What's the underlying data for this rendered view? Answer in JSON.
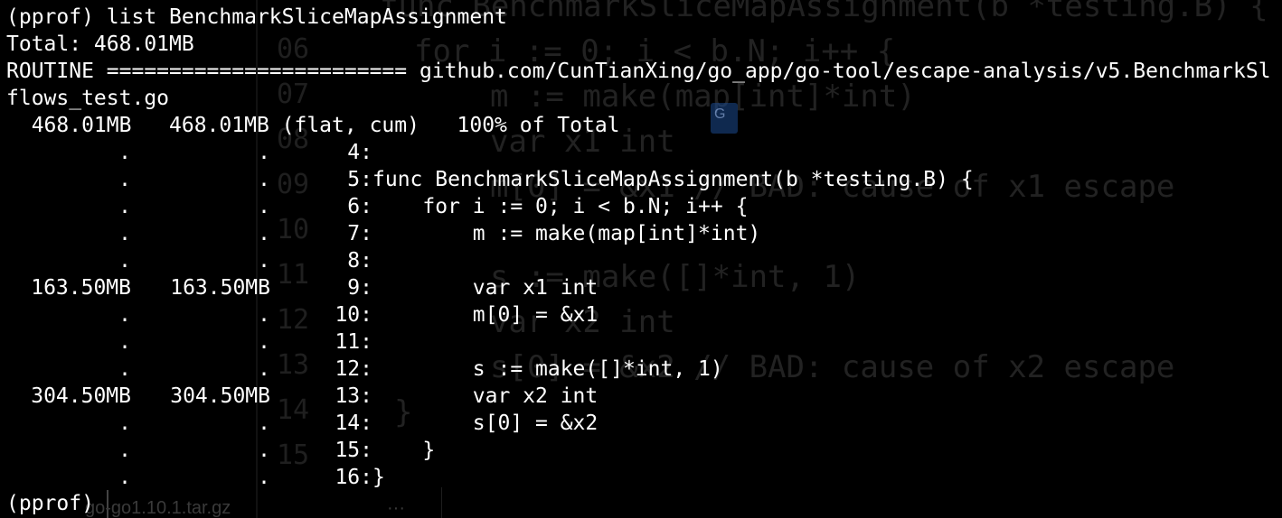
{
  "background_editor": {
    "lines": [
      {
        "num": "",
        "code": "func BenchmarkSliceMapAssignment(b *testing.B) {"
      },
      {
        "num": "06",
        "code": "for i := 0; i < b.N; i++ {"
      },
      {
        "num": "07",
        "code": "m := make(map[int]*int)"
      },
      {
        "num": "08",
        "code": "var x1 int"
      },
      {
        "num": "09",
        "code": "m[0] = &x1 // BAD: cause of x1 escape"
      },
      {
        "num": "10",
        "code": ""
      },
      {
        "num": "11",
        "code": "s := make([]*int, 1)"
      },
      {
        "num": "12",
        "code": "var x2 int"
      },
      {
        "num": "13",
        "code": "s[0] = &x2 // BAD: cause of x2 escape"
      },
      {
        "num": "14",
        "code": "}"
      },
      {
        "num": "15",
        "code": ""
      }
    ],
    "tab_filename": "go-go1.10.1.tar.gz",
    "tab_more": "···"
  },
  "terminal": {
    "command": "(pprof) list BenchmarkSliceMapAssignment",
    "total": "Total: 468.01MB",
    "routine": "ROUTINE ======================== github.com/CunTianXing/go_app/go-tool/escape-analysis/v5.BenchmarkSl",
    "routine_cont": "flows_test.go",
    "summary": "  468.01MB   468.01MB (flat, cum)   100% of Total",
    "rows": [
      {
        "flat": ".",
        "cum": ".",
        "line": "4:",
        "code": ""
      },
      {
        "flat": ".",
        "cum": ".",
        "line": "5:",
        "code": "func BenchmarkSliceMapAssignment(b *testing.B) {"
      },
      {
        "flat": ".",
        "cum": ".",
        "line": "6:",
        "code": "    for i := 0; i < b.N; i++ {"
      },
      {
        "flat": ".",
        "cum": ".",
        "line": "7:",
        "code": "        m := make(map[int]*int)"
      },
      {
        "flat": ".",
        "cum": ".",
        "line": "8:",
        "code": ""
      },
      {
        "flat": "163.50MB",
        "cum": "163.50MB",
        "line": "9:",
        "code": "        var x1 int"
      },
      {
        "flat": ".",
        "cum": ".",
        "line": "10:",
        "code": "        m[0] = &x1"
      },
      {
        "flat": ".",
        "cum": ".",
        "line": "11:",
        "code": ""
      },
      {
        "flat": ".",
        "cum": ".",
        "line": "12:",
        "code": "        s := make([]*int, 1)"
      },
      {
        "flat": "304.50MB",
        "cum": "304.50MB",
        "line": "13:",
        "code": "        var x2 int"
      },
      {
        "flat": ".",
        "cum": ".",
        "line": "14:",
        "code": "        s[0] = &x2"
      },
      {
        "flat": ".",
        "cum": ".",
        "line": "15:",
        "code": "    }"
      },
      {
        "flat": ".",
        "cum": ".",
        "line": "16:",
        "code": "}"
      }
    ],
    "prompt": "(pprof)"
  },
  "colors": {
    "background": "#000000",
    "text": "#ffffff",
    "ghost_text": "#222222"
  }
}
